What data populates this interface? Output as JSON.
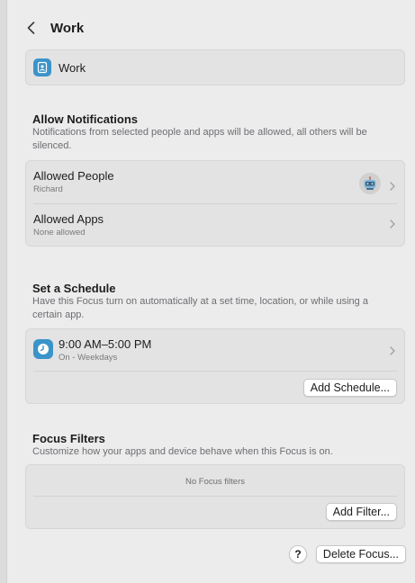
{
  "header": {
    "title": "Work"
  },
  "focus_card": {
    "name": "Work",
    "icon": "person-badge-icon",
    "color": "#3b94c9"
  },
  "allow_notifications": {
    "title": "Allow Notifications",
    "description": "Notifications from selected people and apps will be allowed, all others will be silenced.",
    "rows": [
      {
        "title": "Allowed People",
        "subtitle": "Richard",
        "avatar": "robot-avatar-icon"
      },
      {
        "title": "Allowed Apps",
        "subtitle": "None allowed"
      }
    ]
  },
  "schedule": {
    "title": "Set a Schedule",
    "description": "Have this Focus turn on automatically at a set time, location, or while using a certain app.",
    "item": {
      "time": "9:00 AM–5:00 PM",
      "subtitle": "On - Weekdays",
      "icon": "clock-icon"
    },
    "add_button": "Add Schedule..."
  },
  "filters": {
    "title": "Focus Filters",
    "description": "Customize how your apps and device behave when this Focus is on.",
    "empty_text": "No Focus filters",
    "add_button": "Add Filter..."
  },
  "footer": {
    "help_label": "?",
    "delete_button": "Delete Focus..."
  }
}
